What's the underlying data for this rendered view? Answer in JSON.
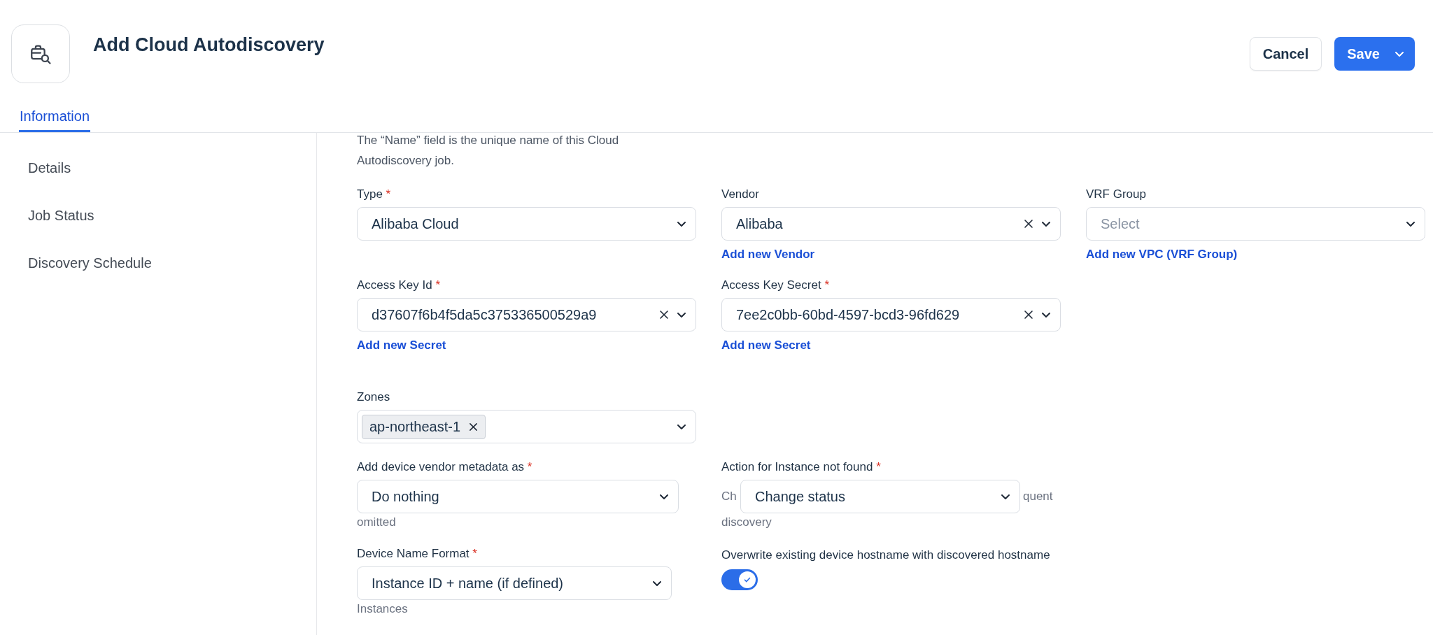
{
  "header": {
    "title": "Add Cloud Autodiscovery",
    "buttons": [
      {
        "label": "Cancel",
        "kind": "secondary"
      },
      {
        "label": "Save",
        "kind": "primary"
      }
    ]
  },
  "tabs": [
    {
      "label": "Information",
      "selected": true
    }
  ],
  "sidebar": {
    "items": [
      {
        "label": "Details"
      },
      {
        "label": "Job Status"
      },
      {
        "label": "Discovery Schedule"
      }
    ]
  },
  "form": {
    "description": "The “Name” field is the unique name of this Cloud Autodiscovery job.",
    "rows": [
      [
        {
          "kind": "select",
          "label": "Type",
          "required_mark": "*",
          "value": "Alibaba Cloud"
        },
        {
          "kind": "select",
          "label": "Vendor",
          "value": "Alibaba",
          "clearable": true,
          "link": "Add new Vendor"
        },
        {
          "kind": "select",
          "label": "VRF Group",
          "placeholder": "Select",
          "link": "Add new VPC (VRF Group)"
        }
      ],
      [
        {
          "kind": "select",
          "label": "Access Key Id",
          "required_mark": "*",
          "value": "d37607f6b4f5da5c375336500529a9",
          "clearable": true,
          "link": "Add new Secret"
        },
        {
          "kind": "select",
          "label": "Access Key Secret",
          "required_mark": "*",
          "value": "7ee2c0bb-60bd-4597-bcd3-96fd629",
          "clearable": true,
          "link": "Add new Secret"
        }
      ],
      [
        {
          "kind": "multiselect",
          "label": "Zones",
          "tags": [
            "ap-northeast-1"
          ]
        }
      ],
      [
        {
          "kind": "select",
          "label": "Add device vendor metadata as",
          "required_mark": "*",
          "value": "Do nothing",
          "help_below": "omitted"
        },
        {
          "kind": "select",
          "label": "Action for Instance not found",
          "required_mark": "*",
          "value": "Change status",
          "help_left": "Ch",
          "help_right": "quent",
          "help_below": "discovery"
        }
      ],
      [
        {
          "kind": "select",
          "label": "Device Name Format",
          "required_mark": "*",
          "value": "Instance ID + name (if defined)",
          "help_below": "Instances"
        },
        {
          "kind": "toggle",
          "label": "Overwrite existing device hostname with discovered hostname",
          "on": true
        }
      ]
    ]
  }
}
